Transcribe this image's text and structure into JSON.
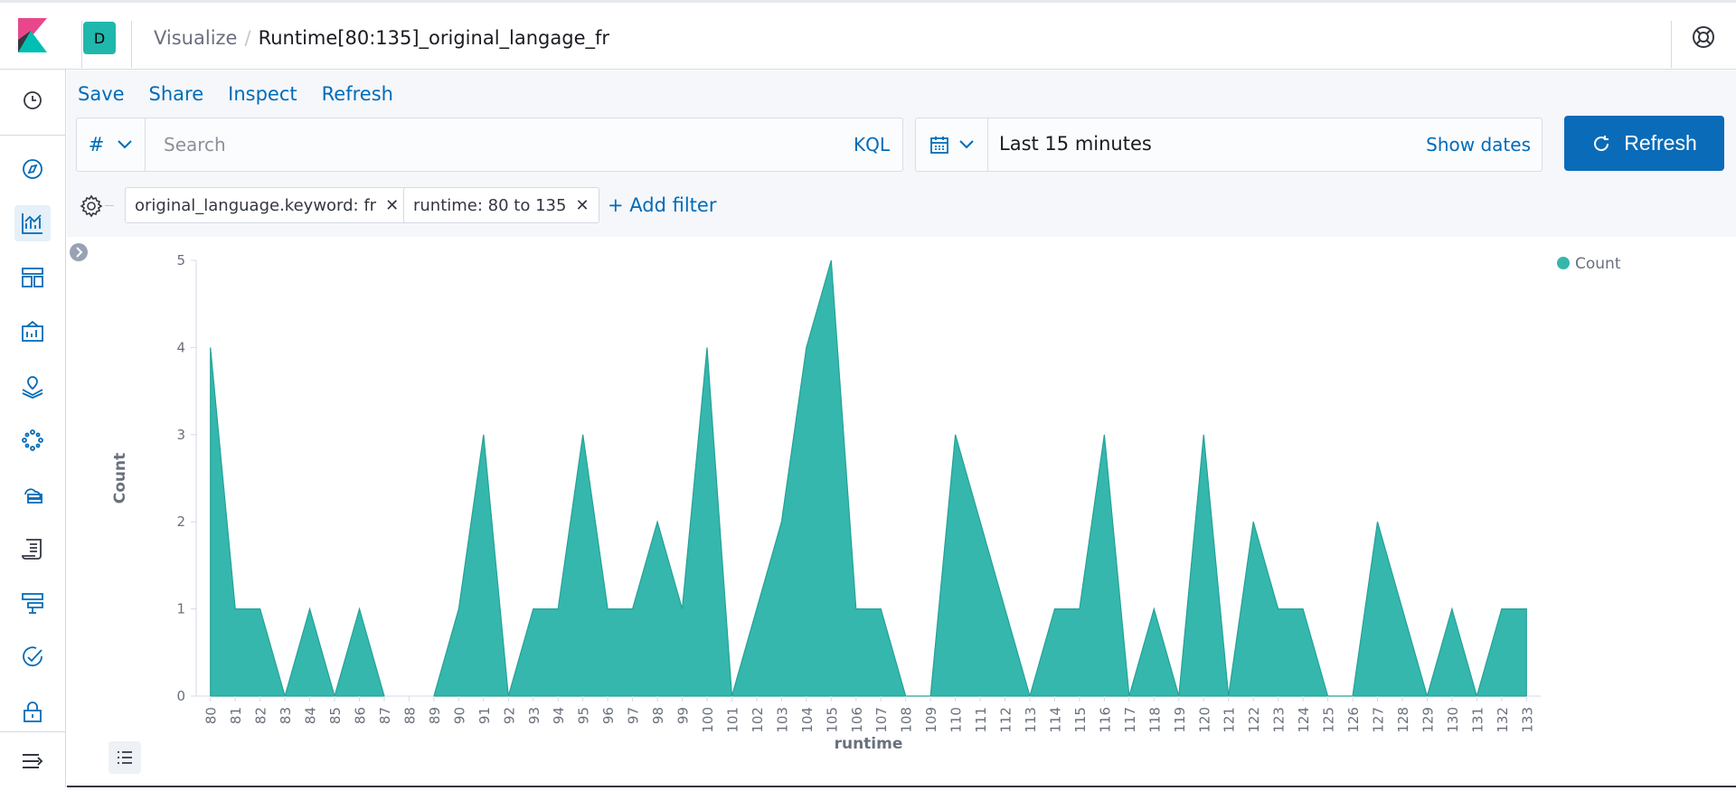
{
  "header": {
    "space_initial": "D",
    "breadcrumb_parent": "Visualize",
    "breadcrumb_separator": "/",
    "breadcrumb_current": "Runtime[80:135]_original_langage_fr"
  },
  "nav": {
    "items": [
      "recently-viewed-icon",
      "discover-icon",
      "visualize-icon",
      "dashboard-icon",
      "canvas-icon",
      "maps-icon",
      "ml-icon",
      "infrastructure-icon",
      "logs-icon",
      "apm-icon",
      "uptime-icon",
      "security-icon"
    ],
    "active": "visualize-icon"
  },
  "menu": {
    "save": "Save",
    "share": "Share",
    "inspect": "Inspect",
    "refresh": "Refresh"
  },
  "query": {
    "language_symbol": "#",
    "placeholder": "Search",
    "language": "KQL"
  },
  "time": {
    "range": "Last 15 minutes",
    "show_dates": "Show dates",
    "refresh_label": "Refresh"
  },
  "filters": {
    "items": [
      "original_language.keyword: fr",
      "runtime: 80 to 135"
    ],
    "add_label": "+ Add filter"
  },
  "colors": {
    "accent": "#006bb8",
    "series": "#35b7ad",
    "series_stroke": "#24a296"
  },
  "chart_data": {
    "type": "area",
    "xlabel": "runtime",
    "ylabel": "Count",
    "ylim": [
      0,
      5
    ],
    "yticks": [
      0,
      1,
      2,
      3,
      4,
      5
    ],
    "legend": "top-right",
    "series": [
      {
        "name": "Count",
        "color": "#35b7ad"
      }
    ],
    "categories": [
      "80",
      "81",
      "82",
      "83",
      "84",
      "85",
      "86",
      "87",
      "88",
      "89",
      "90",
      "91",
      "92",
      "93",
      "94",
      "95",
      "96",
      "97",
      "98",
      "99",
      "100",
      "101",
      "102",
      "103",
      "104",
      "105",
      "106",
      "107",
      "108",
      "109",
      "110",
      "111",
      "112",
      "113",
      "114",
      "115",
      "116",
      "117",
      "118",
      "119",
      "120",
      "121",
      "122",
      "123",
      "124",
      "125",
      "126",
      "127",
      "128",
      "129",
      "130",
      "131",
      "132",
      "133"
    ],
    "values": [
      4,
      1,
      1,
      0,
      1,
      0,
      1,
      0,
      null,
      0,
      1,
      3,
      0,
      1,
      1,
      3,
      1,
      1,
      2,
      1,
      4,
      0,
      1,
      2,
      4,
      5,
      1,
      1,
      0,
      0,
      3,
      2,
      1,
      0,
      1,
      1,
      3,
      0,
      1,
      0,
      3,
      0,
      2,
      1,
      1,
      0,
      0,
      2,
      1,
      0,
      1,
      0,
      1,
      1
    ]
  }
}
